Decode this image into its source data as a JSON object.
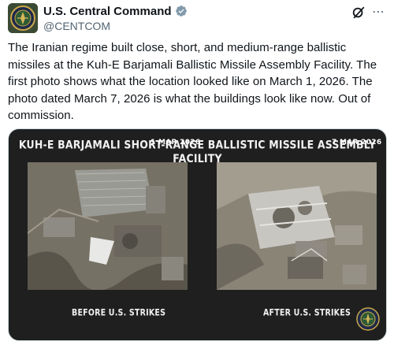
{
  "account": {
    "display_name": "U.S. Central Command",
    "handle": "@CENTCOM",
    "avatar_icon": "centcom-seal-icon",
    "verified_icon": "verified-badge-icon",
    "verified_color": "#829aab"
  },
  "actions": {
    "grok_icon": "grok-icon",
    "more_icon": "more-options-icon"
  },
  "tweet": {
    "text": "The Iranian regime built close, short, and medium-range ballistic missiles at the Kuh-E Barjamali Ballistic Missile Assembly Facility. The first photo shows what the location looked like on March 1, 2026. The photo dated March 7, 2026 is what the buildings look like now. Out of commission."
  },
  "media": {
    "title": "KUH-E BARJAMALI SHORT-RANGE BALLISTIC MISSILE ASSEMBLY FACILITY",
    "before": {
      "date": "1 MAR 2026",
      "caption": "BEFORE U.S. STRIKES"
    },
    "after": {
      "date": "7 MAR 2026",
      "caption": "AFTER U.S. STRIKES"
    },
    "seal_icon": "centcom-seal-icon",
    "background_color": "#1f1f1f"
  }
}
